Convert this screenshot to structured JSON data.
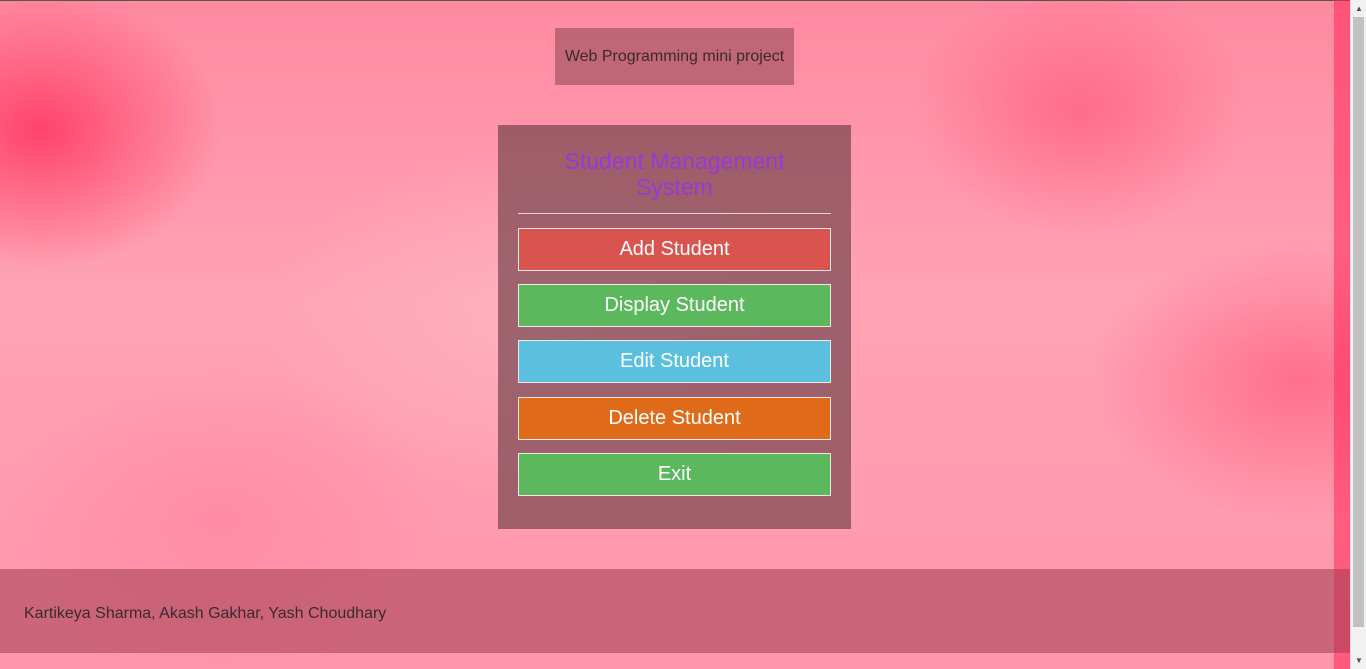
{
  "header": {
    "project_label": "Web Programming mini project"
  },
  "menu": {
    "title": "Student Management System",
    "buttons": [
      {
        "label": "Add Student",
        "color": "#d9534f"
      },
      {
        "label": "Display Student",
        "color": "#5cb85c"
      },
      {
        "label": "Edit Student",
        "color": "#5bc0de"
      },
      {
        "label": "Delete Student",
        "color": "#df6b1a"
      },
      {
        "label": "Exit",
        "color": "#5cb85c"
      }
    ]
  },
  "footer": {
    "credits": "Kartikeya Sharma, Akash Gakhar, Yash Choudhary"
  },
  "colors": {
    "title_color": "#9a37d8",
    "panel_bg": "rgba(120,70,80,0.72)"
  }
}
